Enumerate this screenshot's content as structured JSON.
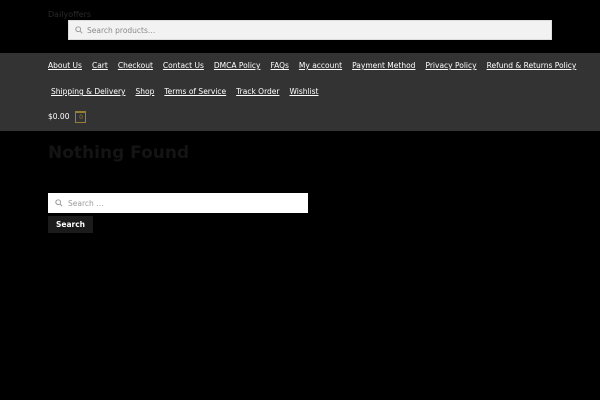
{
  "header": {
    "site_title": "Dailyoffers",
    "product_search": {
      "placeholder": "Search products…",
      "icon": "search-icon"
    }
  },
  "nav": {
    "row1": [
      "About Us",
      "Cart",
      "Checkout",
      "Contact Us",
      "DMCA Policy",
      "FAQs",
      "My account",
      "Payment Method",
      "Privacy Policy",
      "Refund & Returns Policy"
    ],
    "row2": [
      "Shipping & Delivery",
      "Shop",
      "Terms of Service",
      "Track Order",
      "Wishlist"
    ]
  },
  "cart": {
    "amount": "$0.00",
    "count": "0",
    "icon": "cart-count-icon"
  },
  "main": {
    "title": "Nothing Found",
    "search": {
      "placeholder": "Search …",
      "icon": "search-icon",
      "button_label": "Search"
    }
  },
  "colors": {
    "background": "#000000",
    "nav_band": "#333333",
    "accent": "#96802e",
    "button": "#1b1b1b"
  }
}
